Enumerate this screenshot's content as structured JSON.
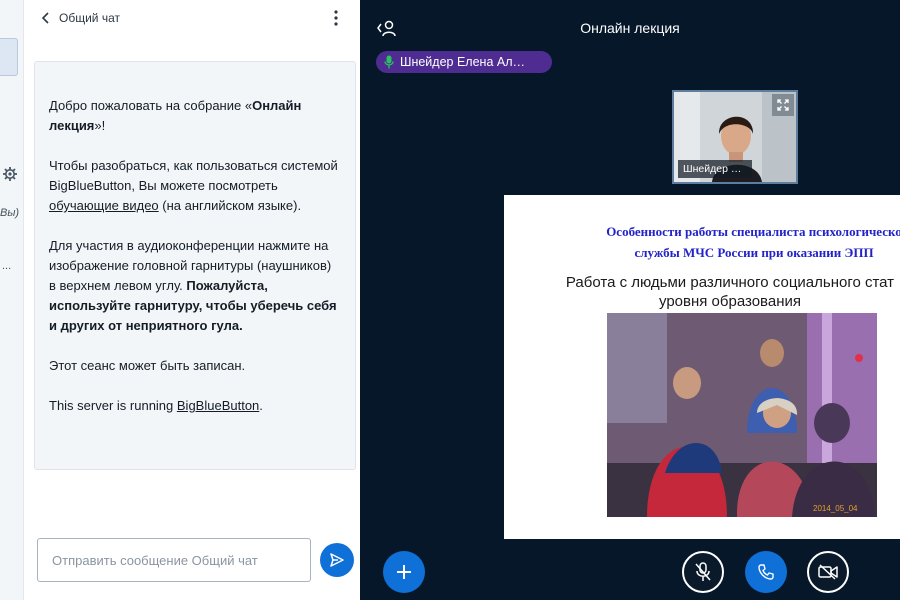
{
  "user_strip": {
    "you_text": "Вы)",
    "truncated_text": "..."
  },
  "chat": {
    "title": "Общий чат",
    "welcome": {
      "p1_before": "Добро пожаловать на собрание «",
      "p1_bold": "Онлайн лекция",
      "p1_after": "»!",
      "p2_before": "Чтобы разобраться, как пользоваться системой BigBlueButton, Вы можете посмотреть ",
      "p2_link": "обучающие видео",
      "p2_after": " (на английском языке).",
      "p3_regular": "Для участия в аудиоконференции нажмите на изображение головной гарнитуры (наушников) в верхнем левом углу. ",
      "p3_bold": "Пожалуйста, используйте гарнитуру, чтобы уберечь себя и других от неприятного гула.",
      "p4": "Этот сеанс может быть записан.",
      "p5_before": "This server is running ",
      "p5_link": "BigBlueButton",
      "p5_after": "."
    },
    "input_placeholder": "Отправить сообщение Общий чат"
  },
  "main": {
    "meeting_title": "Онлайн лекция",
    "talker": "Шнейдер Елена Ал…",
    "webcam_label": "Шнейдер …",
    "slide": {
      "heading_line1": "Особенности работы специалиста психологическо",
      "heading_line2": "службы МЧС России при оказании ЭПП",
      "subtitle_line1": "Работа с людьми различного социального стат",
      "subtitle_line2": "уровня образования",
      "photo_date": "2014_05_04"
    }
  },
  "colors": {
    "primary": "#0f70d7",
    "talker_pill": "#4e2c92",
    "main_bg": "#06172a",
    "slide_heading": "#2323c8"
  },
  "icons": {
    "back": "chevron-left-icon",
    "menu": "more-vertical-icon",
    "send": "send-icon",
    "users": "users-toggle-icon",
    "mic": "microphone-icon",
    "expand": "expand-icon",
    "add": "plus-icon",
    "mute": "microphone-off-icon",
    "phone": "phone-icon",
    "camera": "video-off-icon",
    "settings": "gear-icon"
  }
}
